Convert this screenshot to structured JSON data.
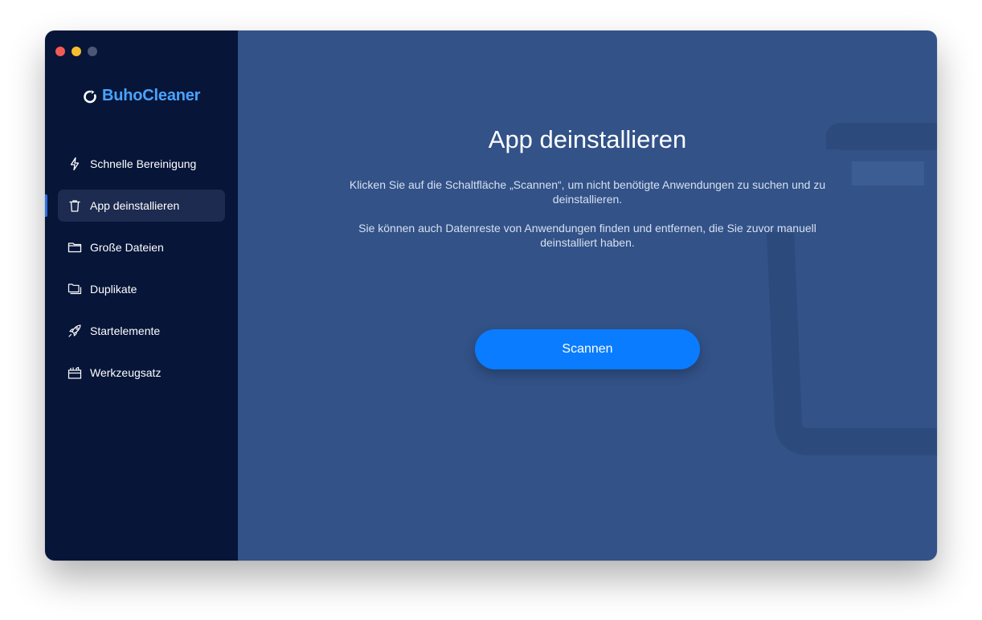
{
  "app": {
    "name": "BuhoCleaner",
    "brand_color": "#4aa3ff"
  },
  "colors": {
    "sidebar_bg": "#061538",
    "main_bg": "#325288",
    "accent": "#0a7cff"
  },
  "sidebar": {
    "items": [
      {
        "label": "Schnelle Bereinigung",
        "icon": "lightning-icon",
        "active": false
      },
      {
        "label": "App deinstallieren",
        "icon": "trash-icon",
        "active": true
      },
      {
        "label": "Große Dateien",
        "icon": "folder-icon",
        "active": false
      },
      {
        "label": "Duplikate",
        "icon": "duplicate-folder-icon",
        "active": false
      },
      {
        "label": "Startelemente",
        "icon": "rocket-icon",
        "active": false
      },
      {
        "label": "Werkzeugsatz",
        "icon": "toolbox-icon",
        "active": false
      }
    ]
  },
  "main": {
    "title": "App deinstallieren",
    "description_1": "Klicken Sie auf die Schaltfläche „Scannen“, um nicht benötigte Anwendungen zu suchen und zu deinstallieren.",
    "description_2": "Sie können auch Datenreste von Anwendungen finden und entfernen, die Sie zuvor manuell deinstalliert haben.",
    "scan_label": "Scannen"
  }
}
